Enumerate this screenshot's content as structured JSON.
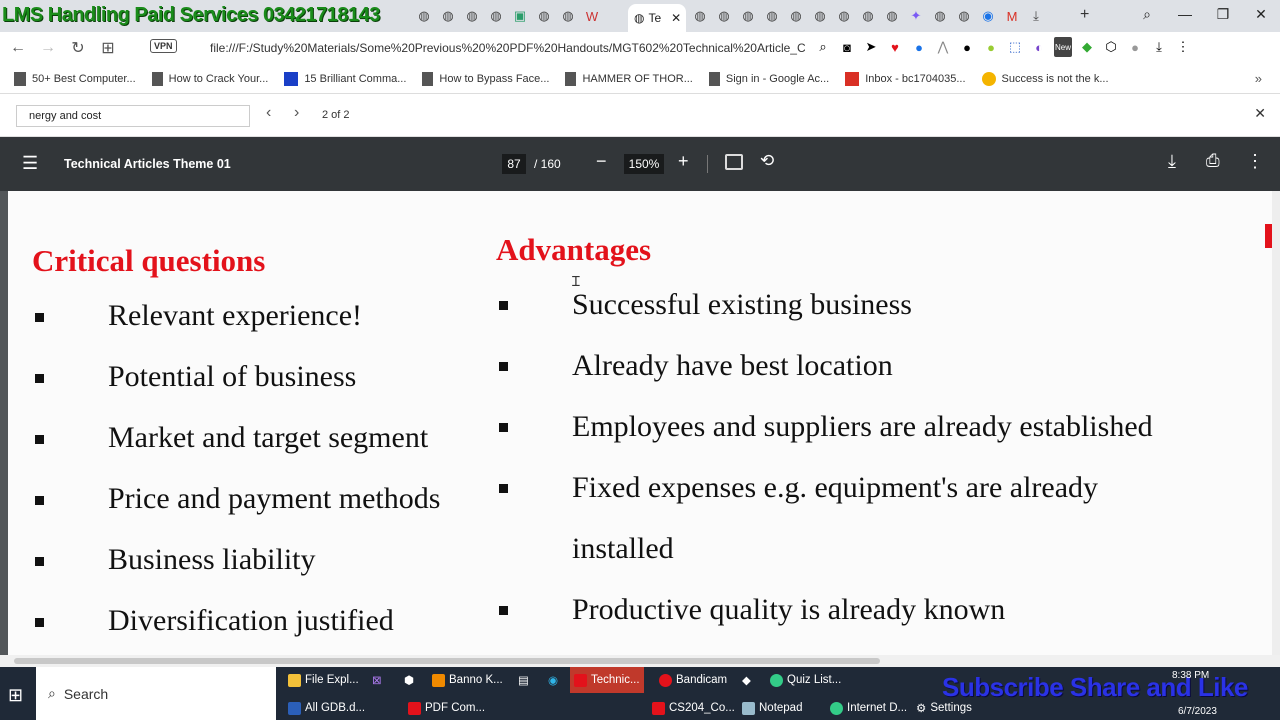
{
  "browser": {
    "overlay_title": "LMS Handling Paid Services 03421718143",
    "active_tab_label": "Te",
    "url": "file:///F:/Study%20Materials/Some%20Previous%20%20PDF%20Handouts/MGT602%20Technical%20Article_C",
    "vpn_label": "VPN",
    "new_badge": "New"
  },
  "bookmarks": [
    {
      "label": "50+ Best Computer..."
    },
    {
      "label": "How to Crack Your..."
    },
    {
      "label": "15 Brilliant Comma..."
    },
    {
      "label": "How to Bypass Face..."
    },
    {
      "label": "HAMMER OF THOR..."
    },
    {
      "label": "Sign in - Google Ac..."
    },
    {
      "label": "Inbox - bc1704035..."
    },
    {
      "label": "Success is not the k..."
    }
  ],
  "find": {
    "query": "nergy and cost",
    "count": "2 of 2"
  },
  "pdf": {
    "title": "Technical Articles Theme 01",
    "page_current": "87",
    "page_total": "/ 160",
    "zoom": "150%"
  },
  "document": {
    "left_heading": "Critical questions",
    "left_items": [
      "Relevant experience!",
      "Potential of business",
      "Market and target segment",
      "Price and payment methods",
      "Business liability",
      "Diversification justified"
    ],
    "right_heading": "Advantages",
    "right_items": [
      "Successful existing business",
      "Already have best location",
      "Employees and suppliers are already established",
      "Fixed expenses e.g. equipment's are already",
      "installed",
      "Productive quality is already known"
    ]
  },
  "taskbar": {
    "search_label": "Search",
    "items_top": [
      "File Expl...",
      "Banno K...",
      "Technic...",
      "Bandicam",
      "Quiz List..."
    ],
    "items_bottom": [
      "All GDB.d...",
      "PDF Com...",
      "CS204_Co...",
      "Notepad",
      "Internet D...",
      "Settings"
    ],
    "banner": "Subscribe Share and Like",
    "time": "8:38 PM",
    "date": "6/7/2023"
  }
}
